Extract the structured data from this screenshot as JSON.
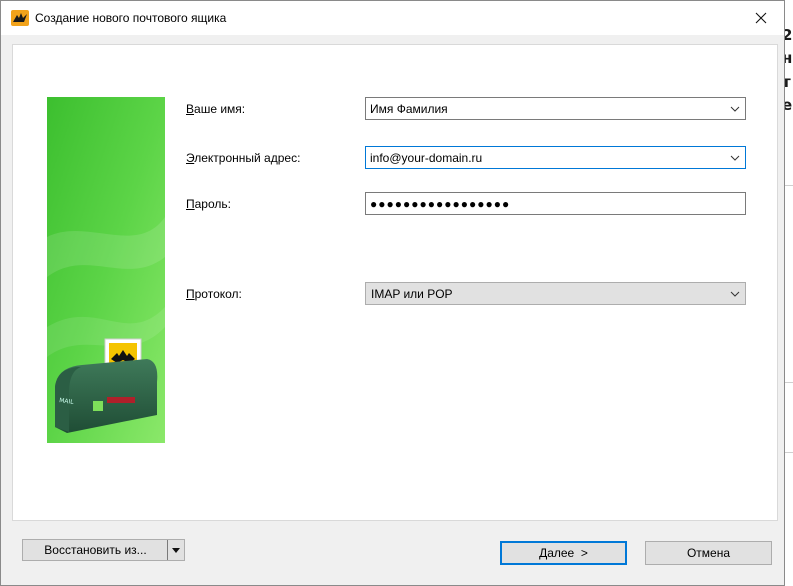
{
  "window": {
    "title": "Создание нового почтового ящика",
    "icon": "the-bat-icon"
  },
  "form": {
    "name_label": "Ваше имя:",
    "name_accel": "В",
    "name_rest": "аше имя:",
    "name_value": "Имя Фамилия",
    "email_label": "Электронный адрес:",
    "email_accel": "Э",
    "email_rest": "лектронный адрес:",
    "email_value": "info@your-domain.ru",
    "password_label": "Пароль:",
    "password_accel": "П",
    "password_rest": "ароль:",
    "password_mask": "●●●●●●●●●●●●●●●●●",
    "protocol_label": "Протокол:",
    "protocol_accel": "П",
    "protocol_rest": "ротокол:",
    "protocol_value": "IMAP или POP"
  },
  "footer": {
    "restore_label": "Восстановить из...",
    "next_label": "Далее  >",
    "cancel_label": "Отмена"
  },
  "background_window": {
    "letters": [
      "2",
      "н",
      "т",
      "е"
    ]
  },
  "colors": {
    "accent": "#0078d7",
    "side_green_light": "#8be86a",
    "side_green_dark": "#3cbf2f"
  }
}
